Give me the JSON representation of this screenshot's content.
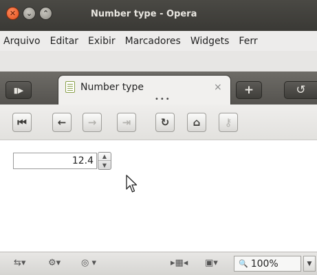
{
  "window": {
    "title": "Number type - Opera",
    "close_glyph": "✕",
    "minimize_glyph": "⌄",
    "maximize_glyph": "⌃"
  },
  "menu": {
    "items": [
      "Arquivo",
      "Editar",
      "Exibir",
      "Marcadores",
      "Widgets",
      "Ferr"
    ]
  },
  "tabbar": {
    "panel_toggle_icon": "▮▶",
    "new_tab_icon": "+",
    "closed_tabs_icon": "↺",
    "tab": {
      "title": "Number type",
      "close_icon": "×",
      "dots": "•••"
    }
  },
  "navbar": {
    "icons": {
      "rewind": "⏮",
      "back": "←",
      "forward": "→",
      "fast_forward": "⇥",
      "reload": "↻",
      "home": "⌂",
      "wand": "⚷"
    }
  },
  "page": {
    "number_input": {
      "value": "12.4"
    },
    "spin_up": "▲",
    "spin_down": "▼"
  },
  "statusbar": {
    "sync_icon": "⇆▾",
    "unite_icon": "⚙▾",
    "turbo_icon": "◎ ▾",
    "panel_icon": "▸▦◂",
    "image_icon": "▣▾",
    "zoom_icon": "🔍",
    "zoom_value": "100%",
    "zoom_arrow": "▼"
  }
}
